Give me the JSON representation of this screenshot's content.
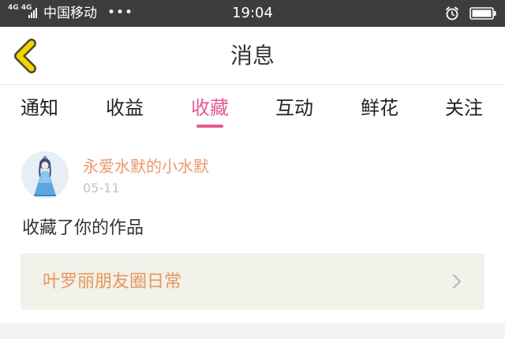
{
  "status_bar": {
    "network": "4G 4G",
    "carrier": "中国移动",
    "more": "•••",
    "time": "19:04",
    "alarm_icon": "alarm-clock-icon",
    "battery_icon": "battery-icon"
  },
  "header": {
    "title": "消息",
    "back_icon": "chevron-left-icon"
  },
  "tabs": [
    {
      "label": "通知",
      "active": false
    },
    {
      "label": "收益",
      "active": false
    },
    {
      "label": "收藏",
      "active": true
    },
    {
      "label": "互动",
      "active": false
    },
    {
      "label": "鲜花",
      "active": false
    },
    {
      "label": "关注",
      "active": false
    }
  ],
  "item": {
    "username": "永爱水默的小水默",
    "date": "05-11",
    "action": "收藏了你的作品",
    "work_title": "叶罗丽朋友圈日常",
    "chevron_icon": "chevron-right-icon",
    "avatar_icon": "avatar-doll-icon"
  },
  "colors": {
    "accent": "#e25c93",
    "username": "#e89a6a",
    "back_arrow": "#f0d400",
    "card_bg": "#f1f2ea"
  }
}
